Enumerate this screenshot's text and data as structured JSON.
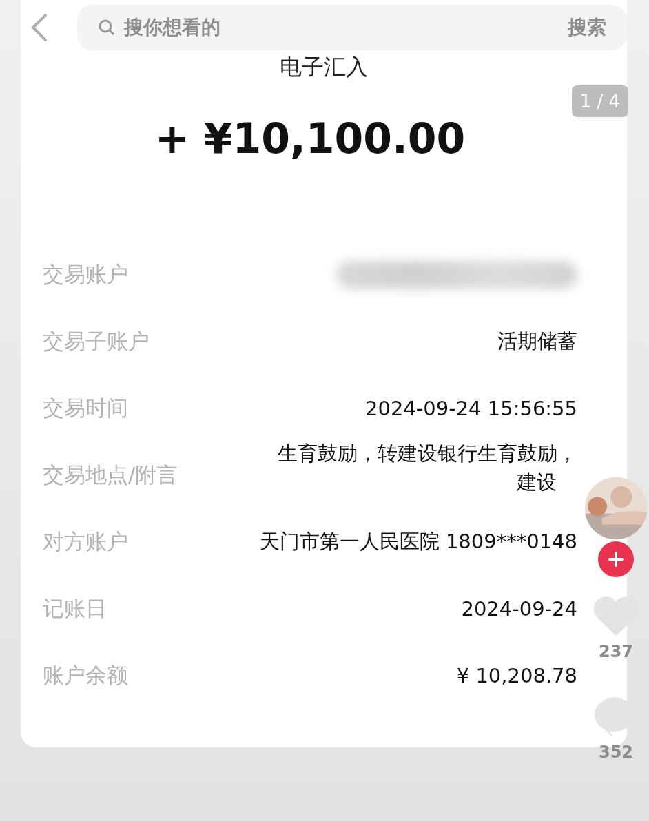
{
  "top_bar": {
    "search": {
      "placeholder": "搜你想看的",
      "button": "搜索"
    }
  },
  "title": "电子汇入",
  "page_indicator": "1 / 4",
  "amount": "+ ¥10,100.00",
  "details": [
    {
      "label": "交易账户",
      "kind": "masked"
    },
    {
      "label": "交易子账户",
      "kind": "text",
      "value": "活期储蓄"
    },
    {
      "label": "交易时间",
      "kind": "text",
      "value": "2024-09-24 15:56:55"
    },
    {
      "label": "交易地点/附言",
      "kind": "multiline",
      "lines": [
        "生育鼓励，转建设银行生育鼓励，",
        "建设"
      ]
    },
    {
      "label": "对方账户",
      "kind": "text",
      "value": "天门市第一人民医院 1809***0148"
    },
    {
      "label": "记账日",
      "kind": "text",
      "value": "2024-09-24"
    },
    {
      "label": "账户余额",
      "kind": "text",
      "value": "¥ 10,208.78"
    }
  ],
  "side_rail": {
    "likes": "237",
    "comments": "352"
  }
}
